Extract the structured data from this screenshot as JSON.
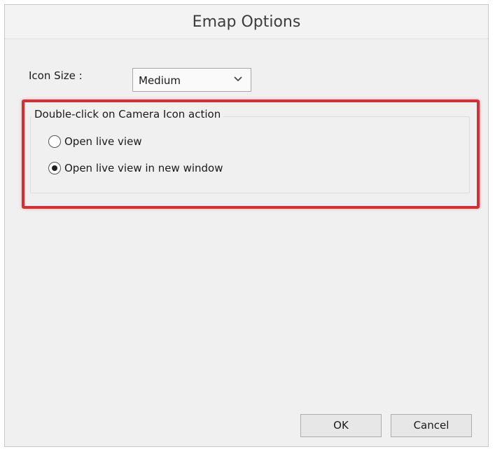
{
  "window": {
    "title": "Emap Options"
  },
  "icon_size": {
    "label": "Icon Size :",
    "selected": "Medium"
  },
  "double_click_group": {
    "legend": "Double-click on Camera Icon action",
    "options": [
      {
        "label": "Open live view",
        "checked": false
      },
      {
        "label": "Open live view in new window",
        "checked": true
      }
    ],
    "highlight_color": "#d62e32"
  },
  "buttons": {
    "ok": "OK",
    "cancel": "Cancel"
  }
}
